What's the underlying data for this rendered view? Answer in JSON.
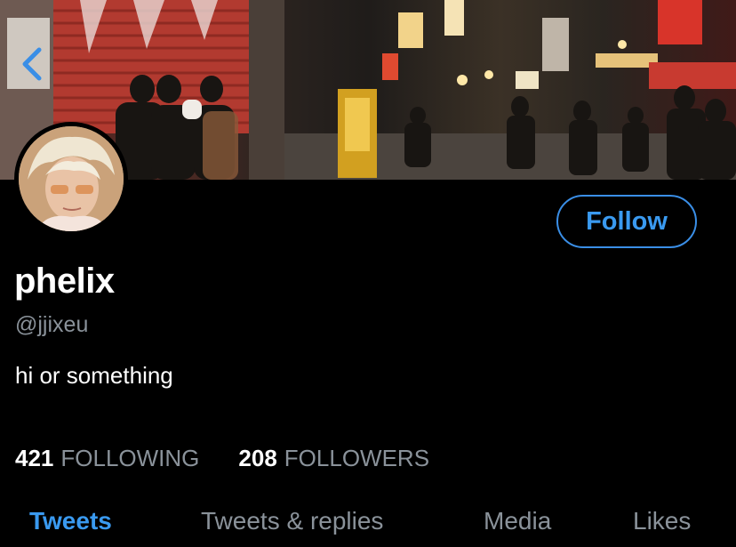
{
  "header": {
    "back_icon": "chevron-left-icon"
  },
  "profile": {
    "display_name": "phelix",
    "handle": "@jjixeu",
    "bio": "hi or something",
    "follow_label": "Follow"
  },
  "stats": {
    "following_count": "421",
    "following_label": "FOLLOWING",
    "followers_count": "208",
    "followers_label": "FOLLOWERS"
  },
  "tabs": [
    {
      "label": "Tweets",
      "active": true
    },
    {
      "label": "Tweets & replies",
      "active": false
    },
    {
      "label": "Media",
      "active": false
    },
    {
      "label": "Likes",
      "active": false
    }
  ],
  "colors": {
    "accent": "#3a9af0",
    "background": "#000000",
    "secondary_text": "#8a929a"
  }
}
